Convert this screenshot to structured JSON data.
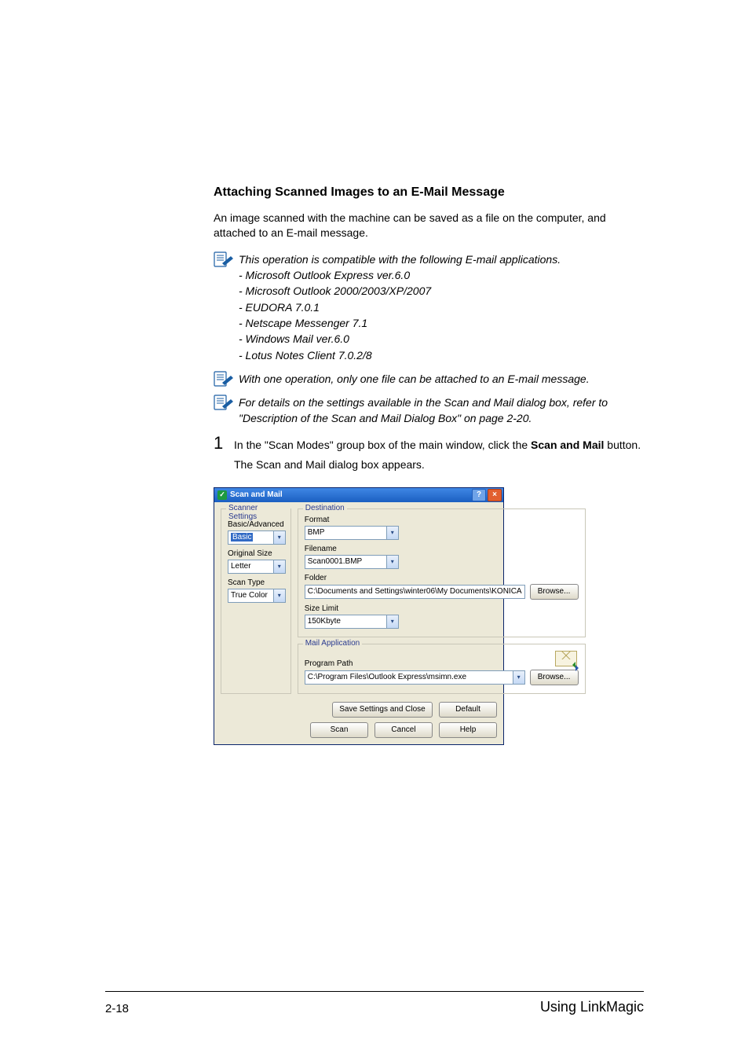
{
  "section": {
    "title": "Attaching Scanned Images to an E-Mail Message",
    "intro": "An image scanned with the machine can be saved as a file on the computer, and attached to an E-mail message."
  },
  "notes": {
    "compat_lead": "This operation is compatible with the following E-mail applications.",
    "compat_items": [
      "- Microsoft Outlook Express ver.6.0",
      "- Microsoft Outlook 2000/2003/XP/2007",
      "- EUDORA 7.0.1",
      "- Netscape Messenger 7.1",
      "- Windows Mail ver.6.0",
      "- Lotus Notes Client 7.0.2/8"
    ],
    "onefile": "With one operation, only one file can be attached to an E-mail message.",
    "details": "For details on the settings available in the Scan and Mail dialog box, refer to \"Description of the Scan and Mail Dialog Box\" on page 2-20."
  },
  "step": {
    "num": "1",
    "text_before": "In the \"Scan Modes\" group box of the main window, click the ",
    "bold": "Scan and Mail",
    "text_after": " button.",
    "result": "The Scan and Mail dialog box appears."
  },
  "dialog": {
    "title": "Scan and Mail",
    "scanner_settings": {
      "legend": "Scanner Settings",
      "basic_advanced_label": "Basic/Advanced",
      "basic_advanced_value": "Basic",
      "original_size_label": "Original Size",
      "original_size_value": "Letter",
      "scan_type_label": "Scan Type",
      "scan_type_value": "True Color"
    },
    "destination": {
      "legend": "Destination",
      "format_label": "Format",
      "format_value": "BMP",
      "filename_label": "Filename",
      "filename_value": "Scan0001.BMP",
      "folder_label": "Folder",
      "folder_value": "C:\\Documents and Settings\\winter06\\My Documents\\KONICA",
      "browse1": "Browse...",
      "sizelimit_label": "Size Limit",
      "sizelimit_value": "150Kbyte"
    },
    "mailapp": {
      "legend": "Mail Application",
      "program_path_label": "Program Path",
      "program_path_value": "C:\\Program Files\\Outlook Express\\msimn.exe",
      "browse2": "Browse..."
    },
    "buttons": {
      "save_close": "Save Settings and Close",
      "default": "Default",
      "scan": "Scan",
      "cancel": "Cancel",
      "help": "Help"
    }
  },
  "footer": {
    "page": "2-18",
    "section": "Using LinkMagic"
  }
}
